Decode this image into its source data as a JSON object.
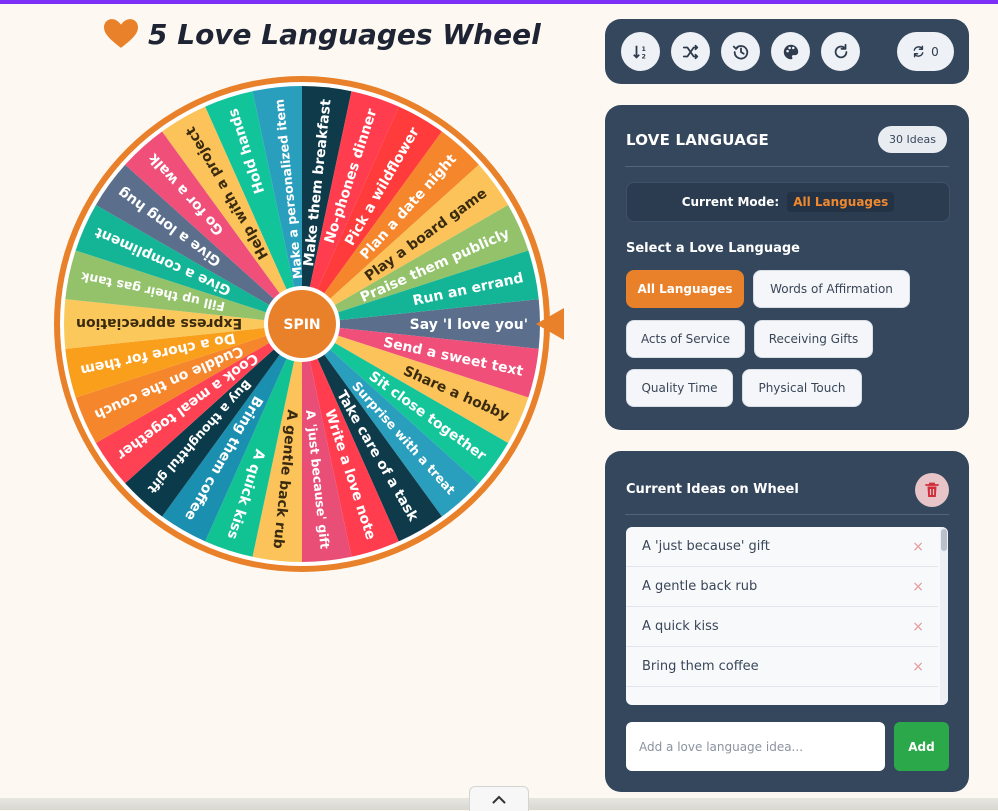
{
  "header": {
    "title": "5 Love Languages Wheel",
    "icon": "heart-icon",
    "icon_color": "#e8812a"
  },
  "wheel": {
    "spin_label": "SPIN",
    "accent": "#e8812a",
    "segments": [
      {
        "label": "Say 'I love you'",
        "color": "#5b6f8c"
      },
      {
        "label": "Send a sweet text",
        "color": "#ef4f78"
      },
      {
        "label": "Share a hobby",
        "color": "#fbc35a"
      },
      {
        "label": "Sit close together",
        "color": "#15c59a"
      },
      {
        "label": "Surprise with a treat",
        "color": "#2a9fbd"
      },
      {
        "label": "Take care of a task",
        "color": "#0f3a4a"
      },
      {
        "label": "Write a love note",
        "color": "#ff3d4f"
      },
      {
        "label": "A 'just because' gift",
        "color": "#e94e77"
      },
      {
        "label": "A gentle back rub",
        "color": "#fbc35a"
      },
      {
        "label": "A quick kiss",
        "color": "#11c293"
      },
      {
        "label": "Bring them coffee",
        "color": "#1b8fb0"
      },
      {
        "label": "Buy a thoughtful gift",
        "color": "#0b3b4a"
      },
      {
        "label": "Cook a meal together",
        "color": "#ff4154"
      },
      {
        "label": "Cuddle on the couch",
        "color": "#f5862b"
      },
      {
        "label": "Do a chore for them",
        "color": "#fa9f1c"
      },
      {
        "label": "Express appreciation",
        "color": "#fbc85c"
      },
      {
        "label": "Fill up their gas tank",
        "color": "#93c26a"
      },
      {
        "label": "Give a compliment",
        "color": "#14b597"
      },
      {
        "label": "Give a long hug",
        "color": "#5b6f8c"
      },
      {
        "label": "Go for a walk",
        "color": "#ef4f78"
      },
      {
        "label": "Help with a project",
        "color": "#fbc35a"
      },
      {
        "label": "Hold hands",
        "color": "#12c49a"
      },
      {
        "label": "Make a personalized item",
        "color": "#2a9fbd"
      },
      {
        "label": "Make them breakfast",
        "color": "#0f3a4a"
      },
      {
        "label": "No-phones dinner",
        "color": "#ff3d4f"
      },
      {
        "label": "Pick a wildflower",
        "color": "#ff3b3b"
      },
      {
        "label": "Plan a date night",
        "color": "#f5862b"
      },
      {
        "label": "Play a board game",
        "color": "#fbc35a"
      },
      {
        "label": "Praise them publicly",
        "color": "#93c26a"
      },
      {
        "label": "Run an errand",
        "color": "#14b597"
      }
    ]
  },
  "toolbar": {
    "buttons": [
      {
        "name": "sort-button",
        "icon": "sort-numeric-icon"
      },
      {
        "name": "shuffle-button",
        "icon": "shuffle-icon"
      },
      {
        "name": "history-button",
        "icon": "history-icon"
      },
      {
        "name": "palette-button",
        "icon": "palette-icon"
      },
      {
        "name": "reset-button",
        "icon": "redo-icon"
      }
    ],
    "spin_count": "0",
    "spin_count_icon": "sync-icon"
  },
  "language_panel": {
    "title": "LOVE LANGUAGE",
    "ideas_badge": "30 Ideas",
    "mode_label": "Current Mode:",
    "mode_value": "All Languages",
    "select_label": "Select a Love Language",
    "options": [
      {
        "label": "All Languages",
        "active": true
      },
      {
        "label": "Words of Affirmation",
        "active": false
      },
      {
        "label": "Acts of Service",
        "active": false
      },
      {
        "label": "Receiving Gifts",
        "active": false
      },
      {
        "label": "Quality Time",
        "active": false
      },
      {
        "label": "Physical Touch",
        "active": false
      }
    ]
  },
  "ideas_panel": {
    "title": "Current Ideas on Wheel",
    "delete_icon": "trash-icon",
    "items": [
      {
        "label": "A 'just because' gift"
      },
      {
        "label": "A gentle back rub"
      },
      {
        "label": "A quick kiss"
      },
      {
        "label": "Bring them coffee"
      }
    ],
    "remove_glyph": "×",
    "input_placeholder": "Add a love language idea...",
    "add_label": "Add"
  },
  "footer": {
    "collapse_icon": "chevron-up-icon"
  }
}
